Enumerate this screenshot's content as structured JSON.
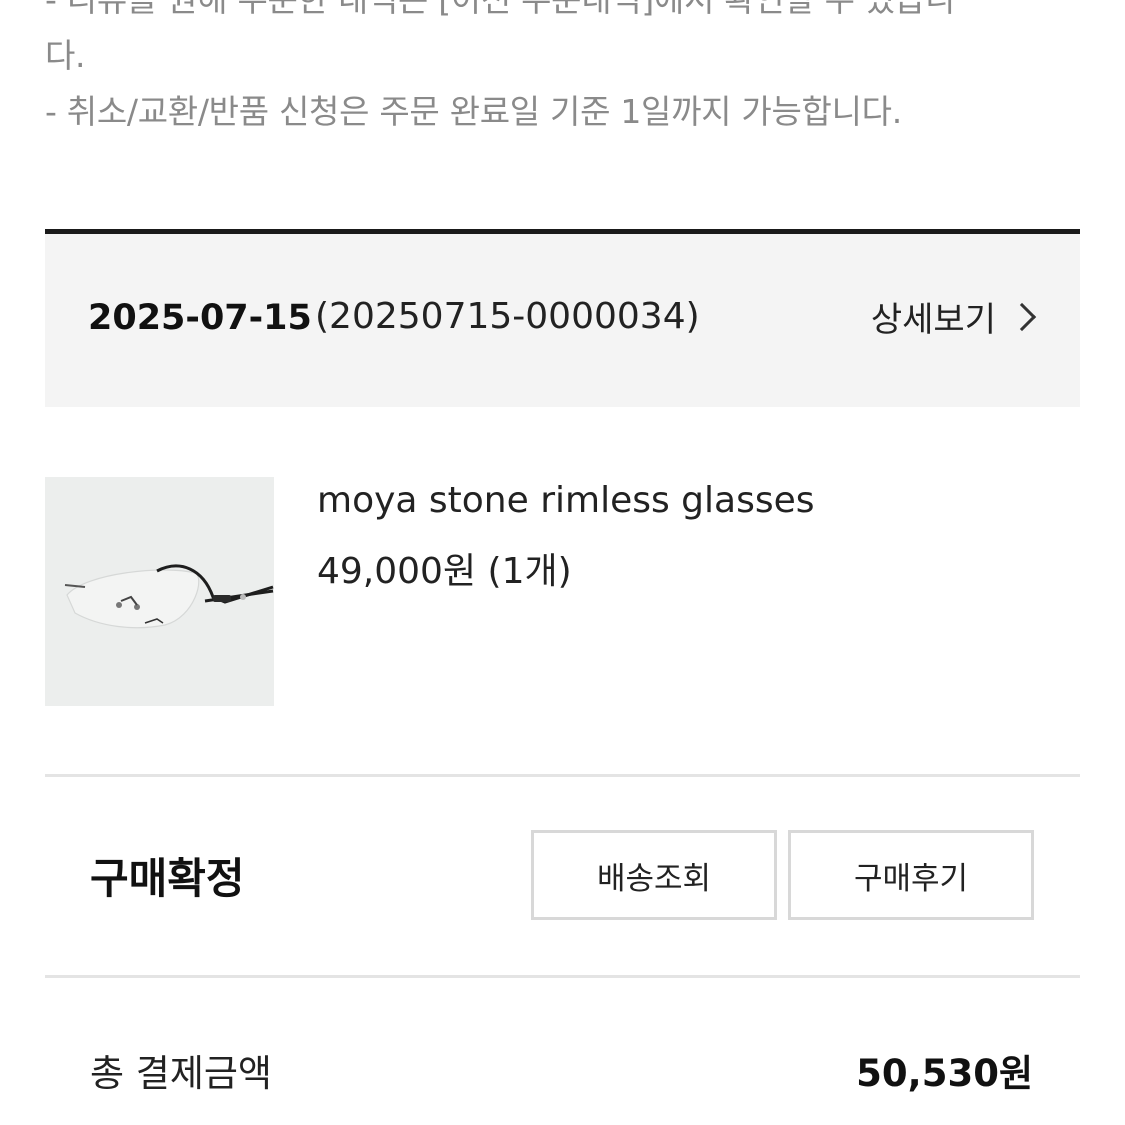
{
  "notice": {
    "line1": "- 리뷰를 원해 주문한 내역은 [이전 주문내역]에서 확인할 수 있습니",
    "line2": "다.",
    "line3": "- 취소/교환/반품 신청은 주문 완료일 기준 1일까지 가능합니다."
  },
  "order": {
    "date": "2025-07-15",
    "number": "(20250715-0000034)",
    "detail_label": "상세보기"
  },
  "product": {
    "name": "moya stone rimless glasses",
    "price": "49,000원 (1개)",
    "image_icon": "glasses-product-photo"
  },
  "status": {
    "label": "구매확정",
    "track_button": "배송조회",
    "review_button": "구매후기"
  },
  "total": {
    "label": "총 결제금액",
    "value": "50,530원"
  },
  "colors": {
    "notice_text": "#8a8a8a",
    "header_bg": "#f4f4f4",
    "rule": "#1a1a1a"
  }
}
